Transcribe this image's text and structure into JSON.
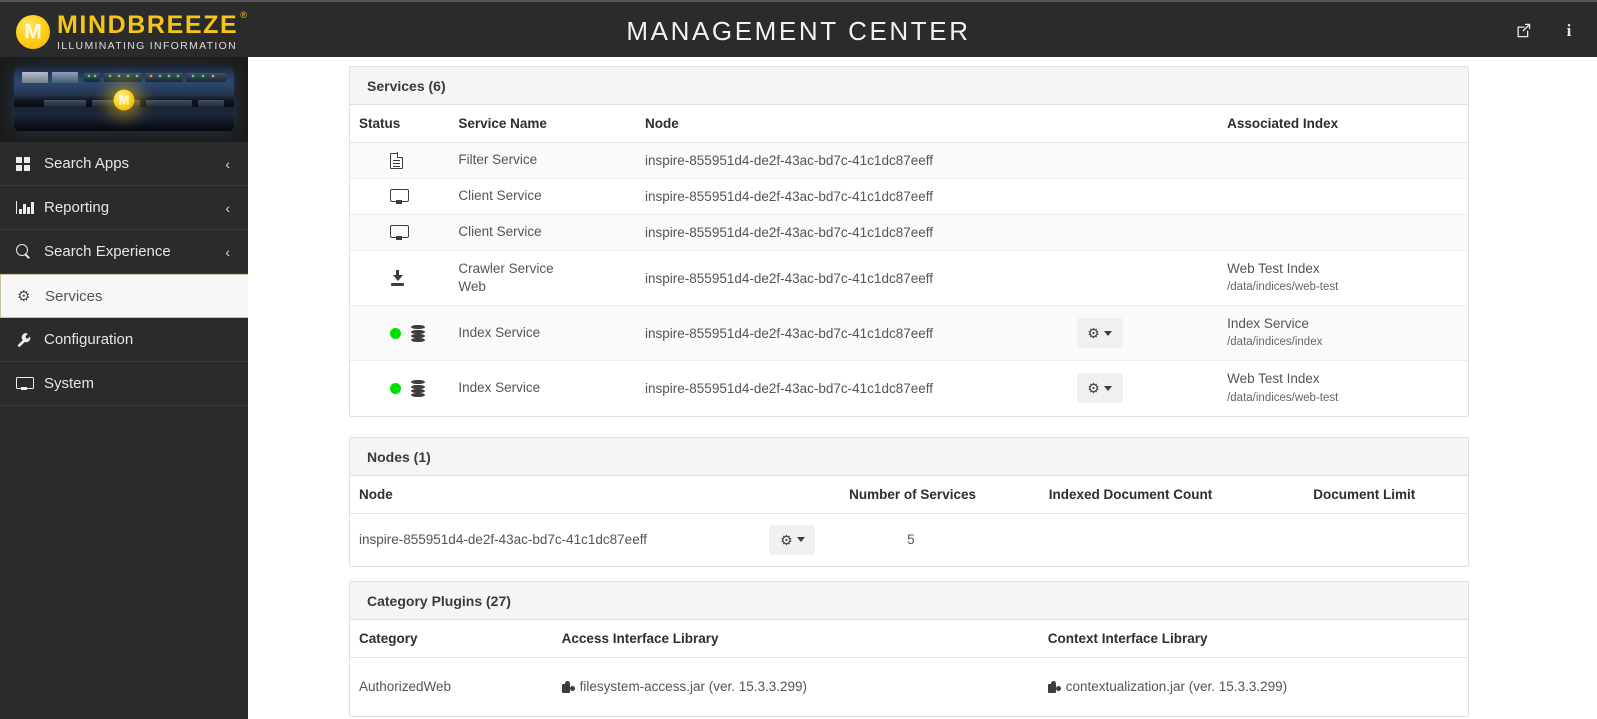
{
  "header": {
    "brand_word": "MINDBREEZE",
    "brand_reg": "®",
    "brand_tagline": "ILLUMINATING INFORMATION",
    "title": "MANAGEMENT CENTER",
    "accent_color": "#f5c518",
    "background_color": "#2b2b2b",
    "icons": {
      "external_link": "external-link-icon",
      "info": "i"
    }
  },
  "sidebar": {
    "hero_alt": "mindbreeze-inspire-appliance",
    "items": [
      {
        "label": "Search Apps",
        "icon": "grid-icon",
        "expandable": true,
        "active": false,
        "chevron": "‹"
      },
      {
        "label": "Reporting",
        "icon": "chart-icon",
        "expandable": true,
        "active": false,
        "chevron": "‹"
      },
      {
        "label": "Search Experience",
        "icon": "search-icon",
        "expandable": true,
        "active": false,
        "chevron": "‹"
      },
      {
        "label": "Services",
        "icon": "gear-icon",
        "expandable": false,
        "active": true,
        "chevron": ""
      },
      {
        "label": "Configuration",
        "icon": "wrench-icon",
        "expandable": false,
        "active": false,
        "chevron": ""
      },
      {
        "label": "System",
        "icon": "monitor-icon",
        "expandable": false,
        "active": false,
        "chevron": ""
      }
    ]
  },
  "services_panel": {
    "title": "Services (6)",
    "columns": [
      "Status",
      "Service Name",
      "Node",
      "",
      "Associated Index"
    ],
    "rows": [
      {
        "status_dot": null,
        "status_icon": "file-icon",
        "service_name": "Filter Service",
        "service_name_sub": "",
        "node": "inspire-855951d4-de2f-43ac-bd7c-41c1dc87eeff",
        "has_gear": false,
        "index_name": "",
        "index_path": ""
      },
      {
        "status_dot": null,
        "status_icon": "desktop-icon",
        "service_name": "Client Service",
        "service_name_sub": "",
        "node": "inspire-855951d4-de2f-43ac-bd7c-41c1dc87eeff",
        "has_gear": false,
        "index_name": "",
        "index_path": ""
      },
      {
        "status_dot": null,
        "status_icon": "desktop-icon",
        "service_name": "Client Service",
        "service_name_sub": "",
        "node": "inspire-855951d4-de2f-43ac-bd7c-41c1dc87eeff",
        "has_gear": false,
        "index_name": "",
        "index_path": ""
      },
      {
        "status_dot": null,
        "status_icon": "download-icon",
        "service_name": "Crawler Service",
        "service_name_sub": "Web",
        "node": "inspire-855951d4-de2f-43ac-bd7c-41c1dc87eeff",
        "has_gear": false,
        "index_name": "Web Test Index",
        "index_path": "/data/indices/web-test"
      },
      {
        "status_dot": "#00e000",
        "status_icon": "database-icon",
        "service_name": "Index Service",
        "service_name_sub": "",
        "node": "inspire-855951d4-de2f-43ac-bd7c-41c1dc87eeff",
        "has_gear": true,
        "index_name": "Index Service",
        "index_path": "/data/indices/index"
      },
      {
        "status_dot": "#00e000",
        "status_icon": "database-icon",
        "service_name": "Index Service",
        "service_name_sub": "",
        "node": "inspire-855951d4-de2f-43ac-bd7c-41c1dc87eeff",
        "has_gear": true,
        "index_name": "Web Test Index",
        "index_path": "/data/indices/web-test"
      }
    ]
  },
  "nodes_panel": {
    "title": "Nodes (1)",
    "columns": [
      "Node",
      "",
      "Number of Services",
      "Indexed Document Count",
      "Document Limit"
    ],
    "rows": [
      {
        "node": "inspire-855951d4-de2f-43ac-bd7c-41c1dc87eeff",
        "has_gear": true,
        "number_of_services": "5",
        "indexed_document_count": "",
        "document_limit": ""
      }
    ]
  },
  "category_plugins_panel": {
    "title": "Category Plugins (27)",
    "columns": [
      "Category",
      "Access Interface Library",
      "Context Interface Library"
    ],
    "rows": [
      {
        "category": "AuthorizedWeb",
        "access_library": "filesystem-access.jar (ver. 15.3.3.299)",
        "context_library": "contextualization.jar (ver. 15.3.3.299)"
      }
    ]
  }
}
